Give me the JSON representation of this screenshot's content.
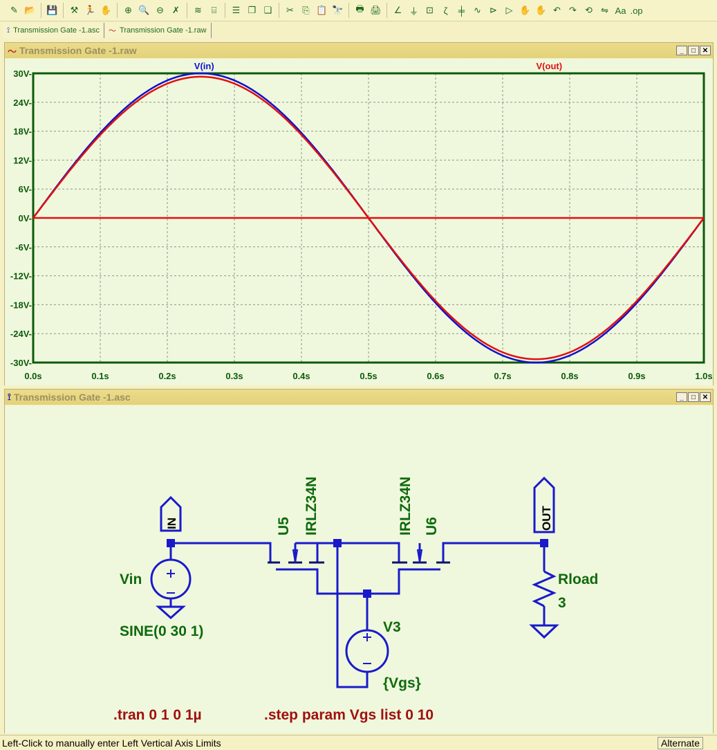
{
  "toolbar": {
    "icons": [
      "new-schematic-icon",
      "open-icon",
      "save-icon",
      "control-panel-icon",
      "run-icon",
      "halt-icon",
      "zoom-in-icon",
      "zoom-area-icon",
      "zoom-out-icon",
      "zoom-fit-icon",
      "autorange-icon",
      "mark-icon",
      "tile-horizontal-icon",
      "cascade-icon",
      "tile-vertical-icon",
      "cut-icon",
      "copy-icon",
      "paste-icon",
      "find-icon",
      "print-setup-icon",
      "print-icon",
      "wire-icon",
      "ground-icon",
      "label-net-icon",
      "resistor-icon",
      "capacitor-icon",
      "inductor-icon",
      "diode-icon",
      "component-icon",
      "move-icon",
      "drag-icon",
      "undo-icon",
      "redo-icon",
      "rotate-icon",
      "mirror-icon",
      "text-icon",
      "spice-directive-icon"
    ],
    "glyphs": [
      "✎",
      "📂",
      "💾",
      "⚒",
      "🏃",
      "✋",
      "⊕",
      "🔍",
      "⊖",
      "✗",
      "≋",
      "⌸",
      "☰",
      "❐",
      "❏",
      "✂",
      "⎘",
      "📋",
      "🔭",
      "🖶",
      "🖨",
      "∠",
      "⏚",
      "⊡",
      "ζ",
      "╪",
      "∿",
      "⊳",
      "▷",
      "✋",
      "✋",
      "↶",
      "↷",
      "⟲",
      "⇋",
      "Aa",
      ".op"
    ]
  },
  "tabs": [
    {
      "label": "Transmission Gate -1.asc"
    },
    {
      "label": "Transmission Gate -1.raw"
    }
  ],
  "plot_window": {
    "title": "Transmission Gate -1.raw"
  },
  "schematic_window": {
    "title": "Transmission Gate -1.asc"
  },
  "chart_data": {
    "type": "line",
    "x_range": [
      0,
      1
    ],
    "y_range": [
      -30,
      30
    ],
    "x_ticks": [
      "0.0s",
      "0.1s",
      "0.2s",
      "0.3s",
      "0.4s",
      "0.5s",
      "0.6s",
      "0.7s",
      "0.8s",
      "0.9s",
      "1.0s"
    ],
    "y_ticks": [
      "30V",
      "24V",
      "18V",
      "12V",
      "6V",
      "0V",
      "-6V",
      "-12V",
      "-18V",
      "-24V",
      "-30V"
    ],
    "grid": true,
    "series": [
      {
        "name": "V(in)",
        "color": "#1010d0",
        "amplitude": 30,
        "frequency": 1
      },
      {
        "name": "V(out)",
        "color": "#e01010",
        "amplitude": 29.3,
        "frequency": 1,
        "step": "Vgs=10"
      },
      {
        "name": "V(out)",
        "color": "#e01010",
        "amplitude": 0,
        "frequency": 1,
        "step": "Vgs=0",
        "legend": false
      }
    ]
  },
  "schematic": {
    "in_label": "IN",
    "out_label": "OUT",
    "vin": {
      "name": "Vin",
      "value": "SINE(0 30 1)"
    },
    "u5": {
      "name": "U5",
      "model": "IRLZ34N"
    },
    "u6": {
      "name": "U6",
      "model": "IRLZ34N"
    },
    "v3": {
      "name": "V3",
      "value": "{Vgs}"
    },
    "rload": {
      "name": "Rload",
      "value": "3"
    },
    "directives": {
      "tran": ".tran 0 1 0 1µ",
      "step": ".step param Vgs list 0 10"
    }
  },
  "status": {
    "message": "Left-Click to manually enter Left Vertical Axis Limits",
    "mode": "Alternate"
  }
}
